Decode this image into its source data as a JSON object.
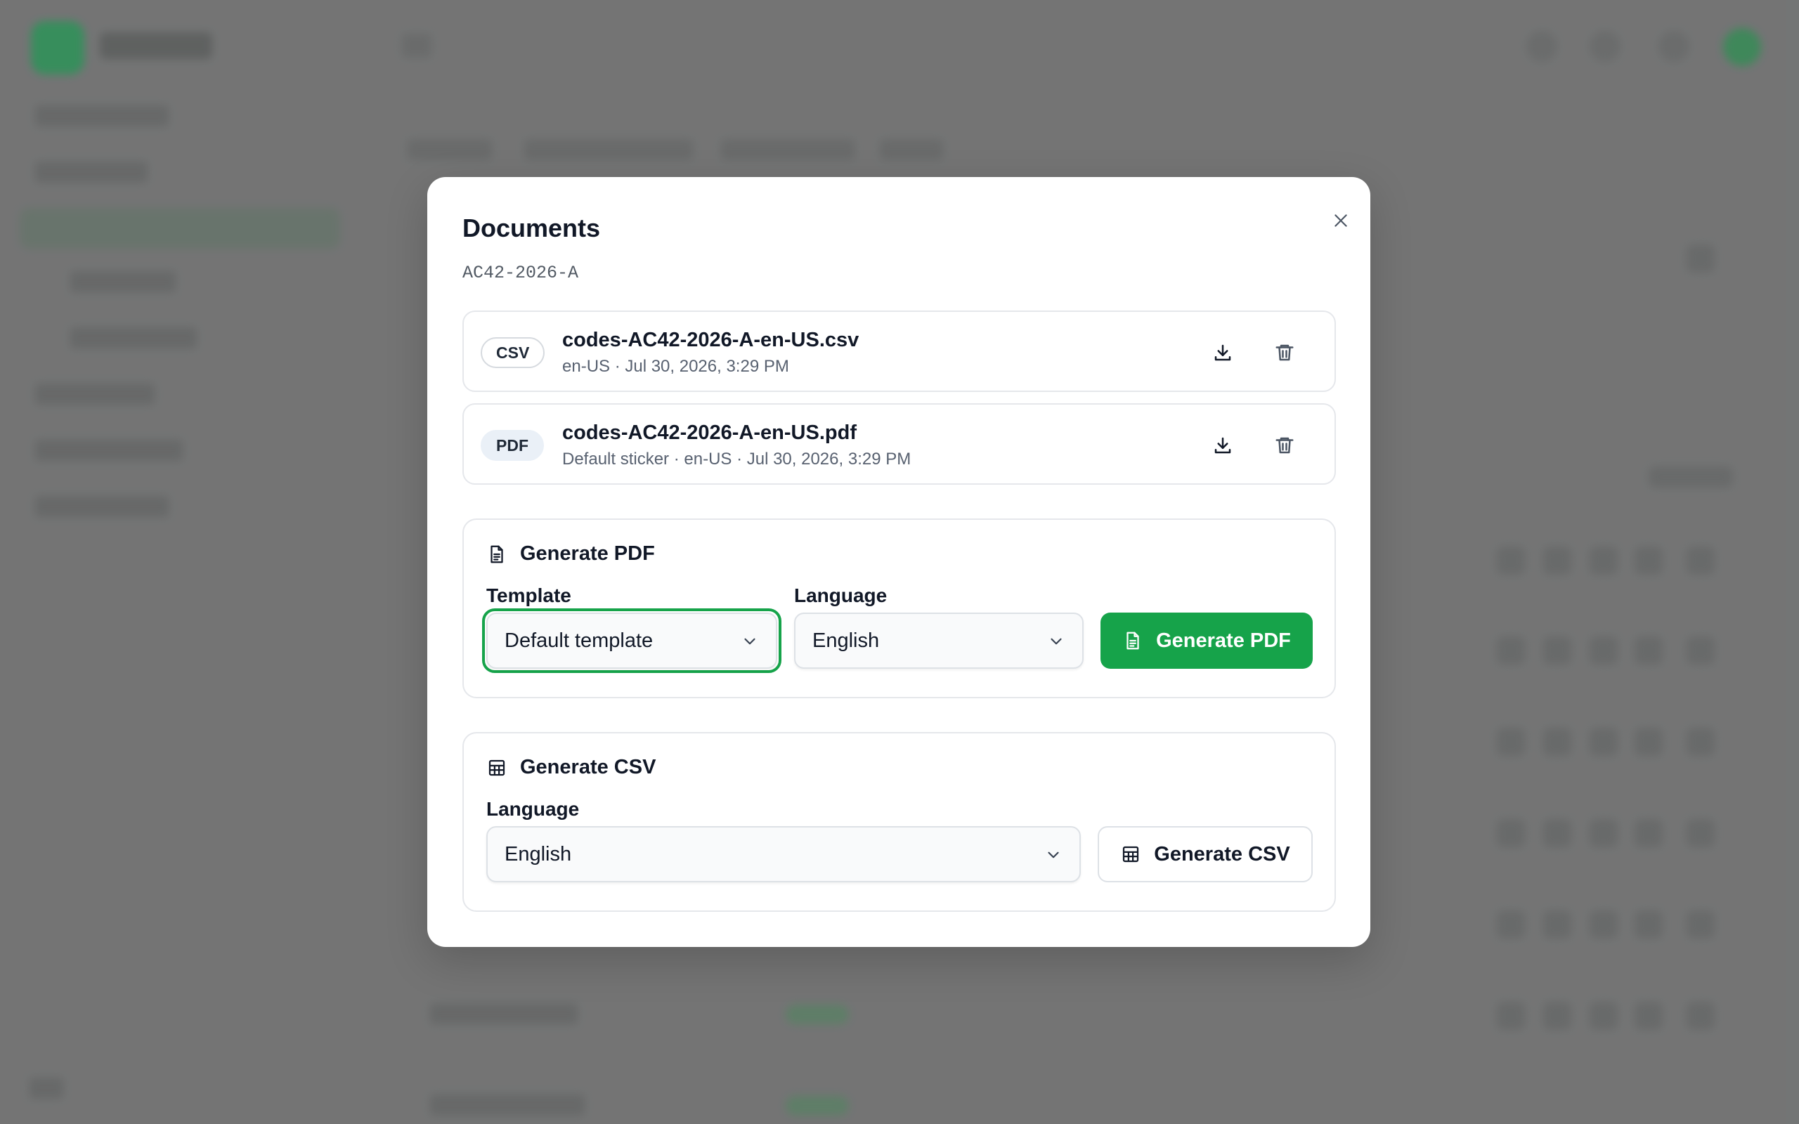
{
  "modal": {
    "title": "Documents",
    "subtitle": "AC42-2026-A",
    "close_icon": "close-icon"
  },
  "files": [
    {
      "type_badge": "CSV",
      "filename": "codes-AC42-2026-A-en-US.csv",
      "meta": "en-US · Jul 30, 2026, 3:29 PM",
      "actions": [
        "download-icon",
        "trash-icon"
      ]
    },
    {
      "type_badge": "PDF",
      "filename": "codes-AC42-2026-A-en-US.pdf",
      "meta": "Default sticker · en-US · Jul 30, 2026, 3:29 PM",
      "actions": [
        "download-icon",
        "trash-icon"
      ]
    }
  ],
  "generate_pdf": {
    "heading": "Generate PDF",
    "heading_icon": "document-icon",
    "template_label": "Template",
    "template_value": "Default template",
    "language_label": "Language",
    "language_value": "English",
    "button_label": "Generate PDF",
    "button_icon": "document-icon"
  },
  "generate_csv": {
    "heading": "Generate CSV",
    "heading_icon": "table-icon",
    "language_label": "Language",
    "language_value": "English",
    "button_label": "Generate CSV",
    "button_icon": "table-icon"
  },
  "colors": {
    "accent": "#16a34a",
    "focus_ring": "#16a34a",
    "backdrop": "#7c7d7d"
  }
}
